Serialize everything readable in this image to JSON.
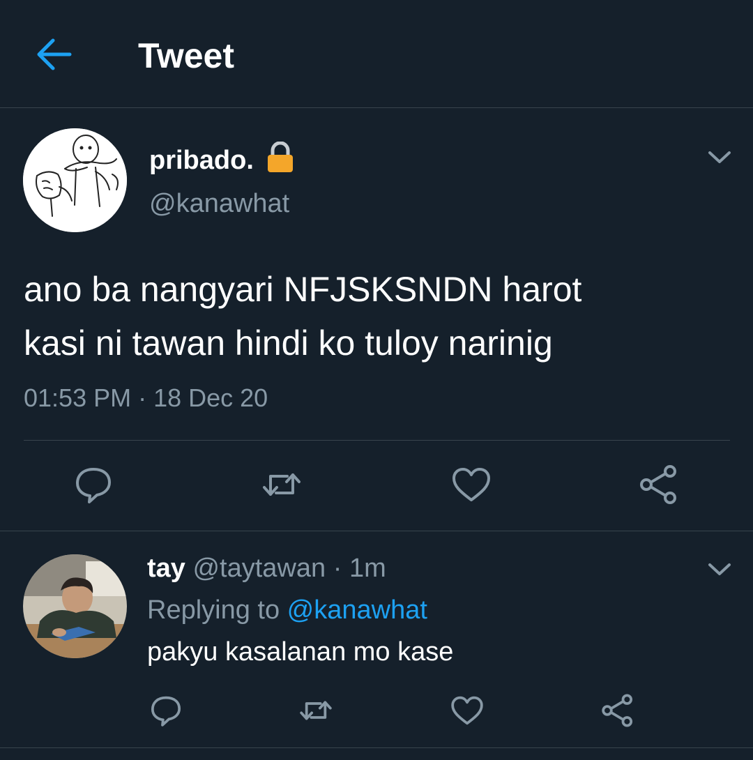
{
  "colors": {
    "background": "#15202b",
    "accent": "#1da1f2",
    "muted": "#8899a6",
    "divider": "#38444d",
    "lock": "#f4a62a"
  },
  "header": {
    "title": "Tweet",
    "back_icon": "arrow-left-icon"
  },
  "main_tweet": {
    "display_name": "pribado.",
    "lock_icon": "lock-icon",
    "handle": "@kanawhat",
    "text_line1": "ano ba nangyari NFJSKSNDN harot",
    "text_line2": "kasi ni tawan hindi ko tuloy narinig",
    "timestamp": "01:53 PM · 18 Dec 20",
    "actions": [
      "reply-icon",
      "retweet-icon",
      "like-icon",
      "share-icon"
    ]
  },
  "reply": {
    "display_name": "tay",
    "handle": "@taytawan",
    "separator": " · ",
    "time": "1m",
    "replying_prefix": "Replying to ",
    "replying_to": "@kanawhat",
    "text": "pakyu kasalanan mo kase",
    "actions": [
      "reply-icon",
      "retweet-icon",
      "like-icon",
      "share-icon"
    ]
  }
}
